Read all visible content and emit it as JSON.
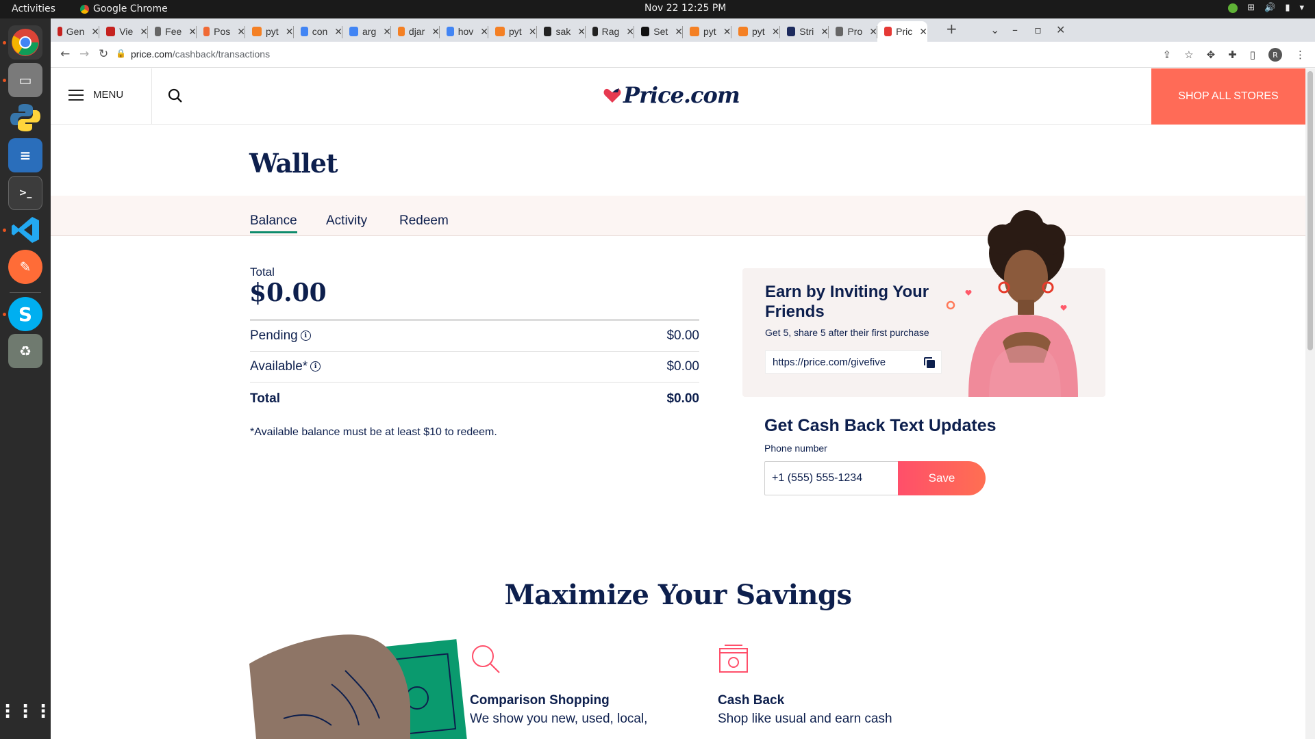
{
  "system": {
    "activities": "Activities",
    "app_name": "Google Chrome",
    "clock": "Nov 22  12:25 PM"
  },
  "browser": {
    "tabs": [
      {
        "label": "Gen",
        "color": "#c5221f"
      },
      {
        "label": "Vie",
        "color": "#c5221f"
      },
      {
        "label": "Fee",
        "color": "#666666"
      },
      {
        "label": "Pos",
        "color": "#f06a35"
      },
      {
        "label": "pyt",
        "color": "#f48024"
      },
      {
        "label": "con",
        "color": "#4285f4"
      },
      {
        "label": "arg",
        "color": "#4285f4"
      },
      {
        "label": "djar",
        "color": "#f48024"
      },
      {
        "label": "hov",
        "color": "#4285f4"
      },
      {
        "label": "pyt",
        "color": "#f48024"
      },
      {
        "label": "sak",
        "color": "#222222"
      },
      {
        "label": "Rag",
        "color": "#222222"
      },
      {
        "label": "Set",
        "color": "#111111"
      },
      {
        "label": "pyt",
        "color": "#f48024"
      },
      {
        "label": "pyt",
        "color": "#f48024"
      },
      {
        "label": "Stri",
        "color": "#1d2b5e"
      },
      {
        "label": "Pro",
        "color": "#666666"
      },
      {
        "label": "Pric",
        "color": "#e53935"
      }
    ],
    "url_host": "price.com",
    "url_path": "/cashback/transactions",
    "avatar_letter": "R"
  },
  "header": {
    "menu_label": "MENU",
    "logo_text": "Price.com",
    "shop_all_label": "SHOP ALL STORES"
  },
  "wallet": {
    "title": "Wallet",
    "tabs": [
      "Balance",
      "Activity",
      "Redeem"
    ],
    "total_label": "Total",
    "total_amount": "$0.00",
    "rows": [
      {
        "label": "Pending",
        "value": "$0.00"
      },
      {
        "label": "Available*",
        "value": "$0.00"
      },
      {
        "label": "Total",
        "value": "$0.00"
      }
    ],
    "note": "*Available balance must be at least $10 to redeem."
  },
  "invite": {
    "title": "Earn by Inviting Your Friends",
    "subtitle": "Get 5, share 5 after their first purchase",
    "link": "https://price.com/givefive"
  },
  "sms": {
    "title": "Get Cash Back Text Updates",
    "phone_label": "Phone number",
    "phone_value": "+1 (555) 555-1234",
    "save_label": "Save"
  },
  "savings": {
    "title": "Maximize Your Savings",
    "features": [
      {
        "title": "Comparison Shopping",
        "text": "We show you new, used, local,"
      },
      {
        "title": "Cash Back",
        "text": "Shop like usual and earn cash"
      }
    ]
  },
  "colors": {
    "brand_navy": "#0d1f4d",
    "accent_coral": "#ff6b57",
    "tab_underline": "#0e8b6c"
  }
}
